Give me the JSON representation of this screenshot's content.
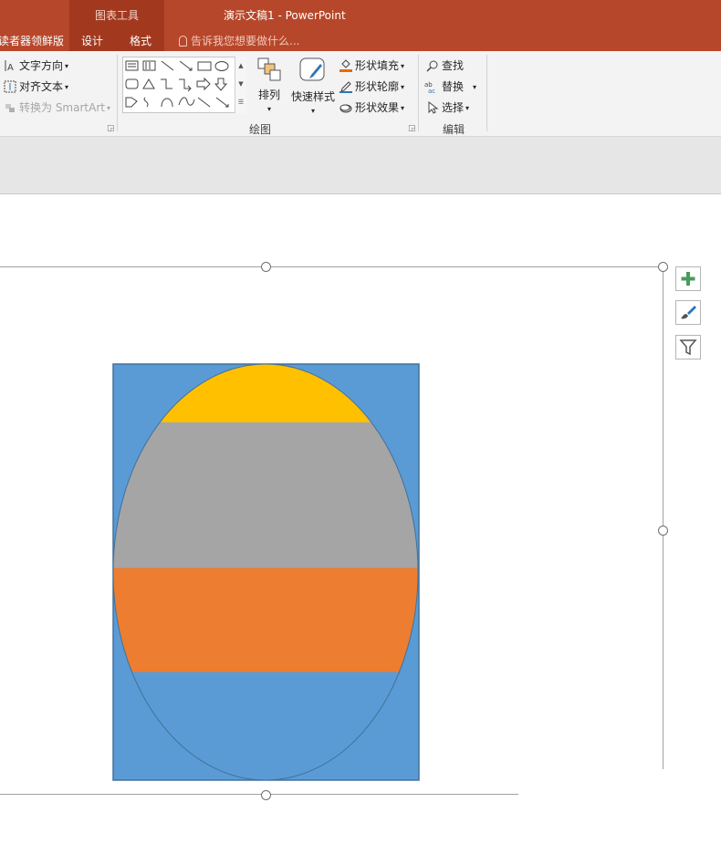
{
  "titlebar": {
    "context_tab_group": "图表工具",
    "document_title": "演示文稿1 - PowerPoint",
    "tabs": [
      "读者器领鲜版",
      "设计",
      "格式"
    ],
    "tell_me_placeholder": "告诉我您想要做什么..."
  },
  "ribbon": {
    "text_group": {
      "text_direction": "文字方向",
      "align_text": "对齐文本",
      "convert_smartart": "转换为 SmartArt"
    },
    "drawing_group": {
      "label": "绘图",
      "arrange": "排列",
      "quick_styles": "快速样式",
      "shape_fill": "形状填充",
      "shape_outline": "形状轮廓",
      "shape_effects": "形状效果"
    },
    "editing_group": {
      "label": "编辑",
      "find": "查找",
      "replace": "替换",
      "select": "选择"
    }
  },
  "colors": {
    "titlebar": "#b7472a",
    "context_group": "#a2391f",
    "rect_fill": "#5b9bd5",
    "top_band": "#ffc000",
    "middle_band": "#a5a5a5",
    "lower_band": "#ed7d31",
    "fill_icon": "#e46c0a",
    "outline_icon": "#2e75b6"
  },
  "chart_data": {
    "type": "pie",
    "note": "",
    "bands": [
      {
        "color": "#ffc000",
        "share": 0.14
      },
      {
        "color": "#a5a5a5",
        "share": 0.35
      },
      {
        "color": "#ed7d31",
        "share": 0.25
      },
      {
        "color": "#5b9bd5",
        "share": 0.26
      }
    ]
  }
}
